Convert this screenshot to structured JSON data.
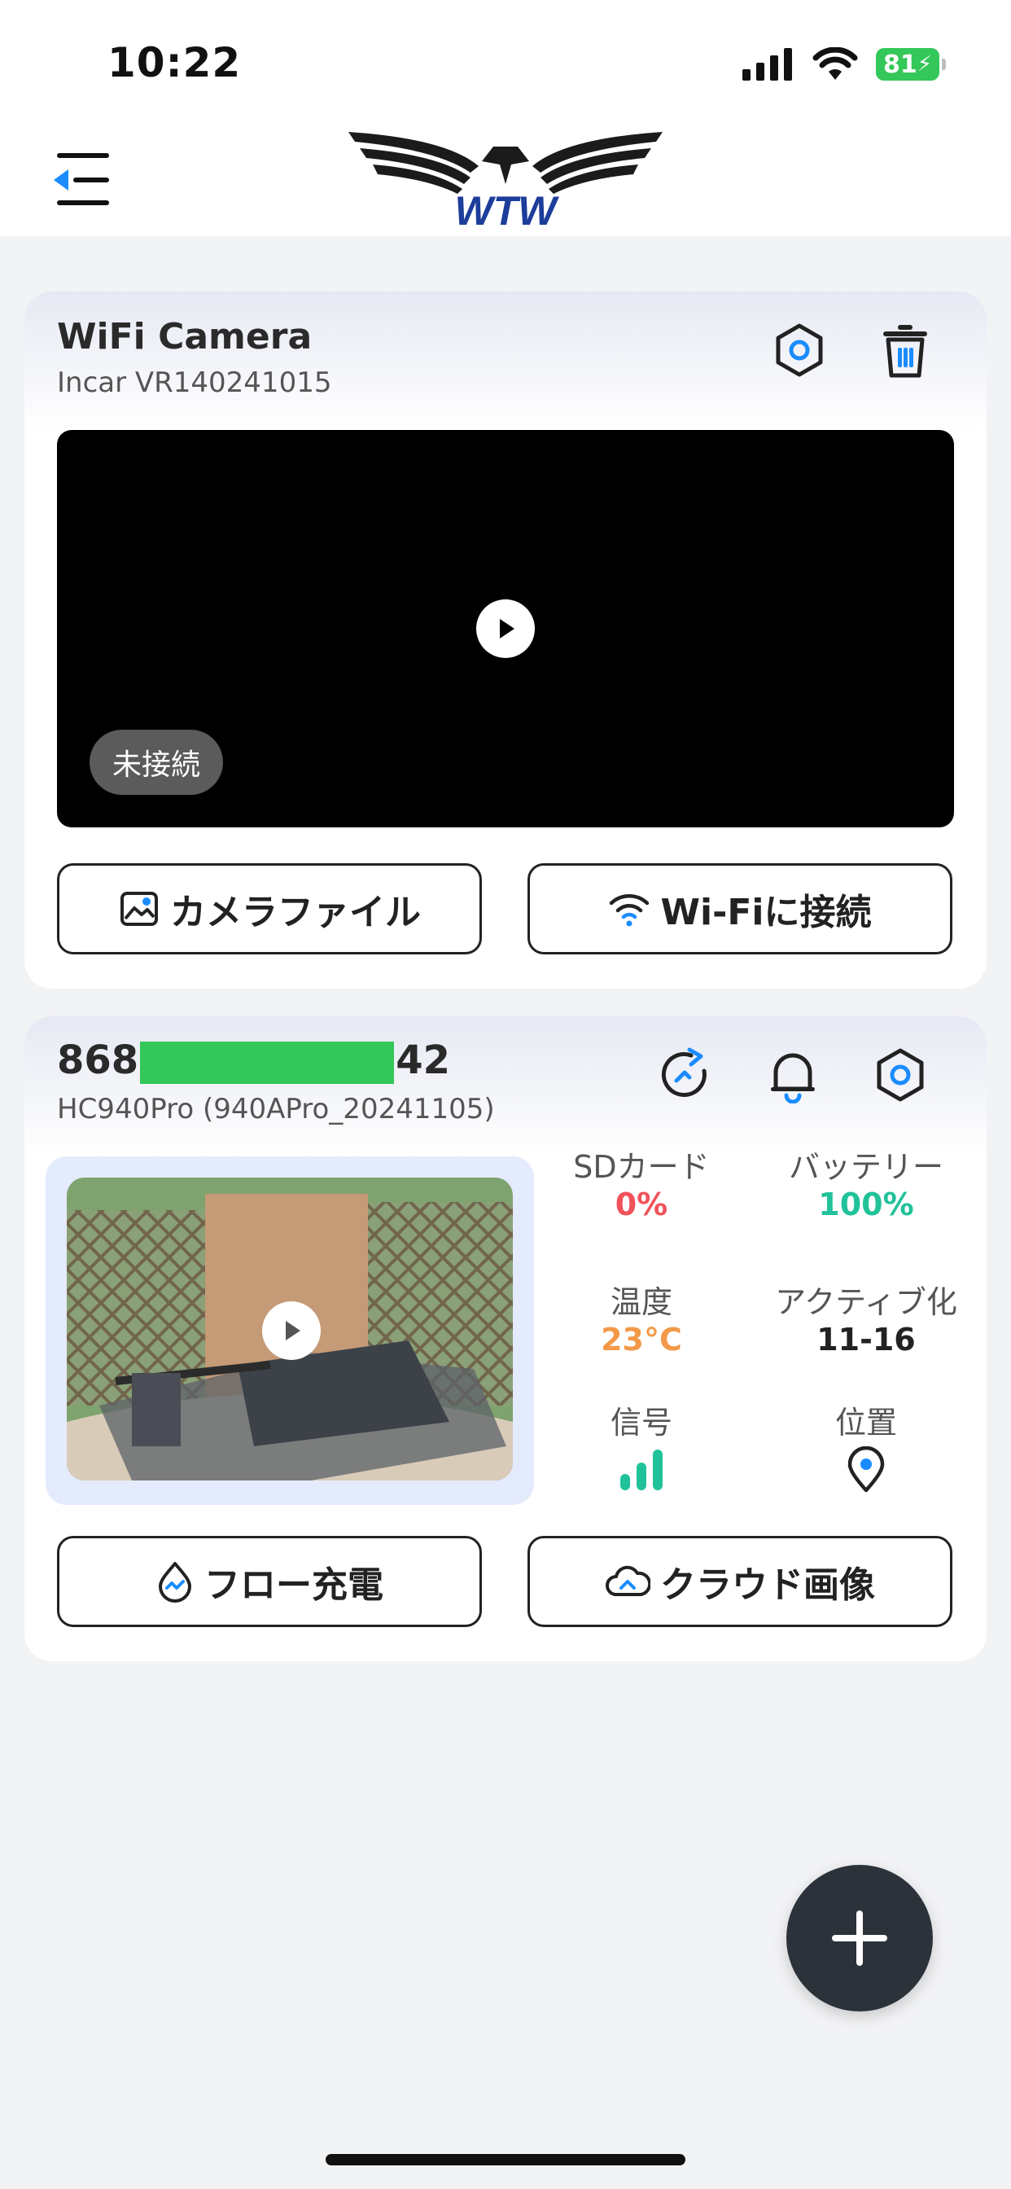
{
  "status_bar": {
    "time": "10:22",
    "battery": "81"
  },
  "camera_card": {
    "title": "WiFi Camera",
    "subtitle": "Incar VR140241015",
    "status_badge": "未接続",
    "file_button": "カメラファイル",
    "wifi_button": "Wi-Fiに接続"
  },
  "device_card": {
    "id_prefix": "868",
    "id_suffix": "42",
    "subtitle": "HC940Pro (940APro_20241105)",
    "stats": {
      "sd_label": "SDカード",
      "sd_value": "0%",
      "battery_label": "バッテリー",
      "battery_value": "100%",
      "temp_label": "温度",
      "temp_value": "23°C",
      "active_label": "アクティブ化",
      "active_value": "11-16",
      "signal_label": "信号",
      "location_label": "位置"
    },
    "flow_button": "フロー充電",
    "cloud_button": "クラウド画像"
  },
  "colors": {
    "accent": "#1a8cff",
    "danger": "#f0525a",
    "success": "#21c29a",
    "warning": "#f2994a",
    "fab": "#2c323a"
  },
  "icons": [
    "menu-back-icon",
    "settings-hex-icon",
    "trash-icon",
    "play-icon",
    "image-icon",
    "wifi-icon",
    "refresh-icon",
    "bell-icon",
    "signal-bars-icon",
    "location-pin-icon",
    "flow-drop-icon",
    "cloud-icon",
    "plus-icon"
  ]
}
